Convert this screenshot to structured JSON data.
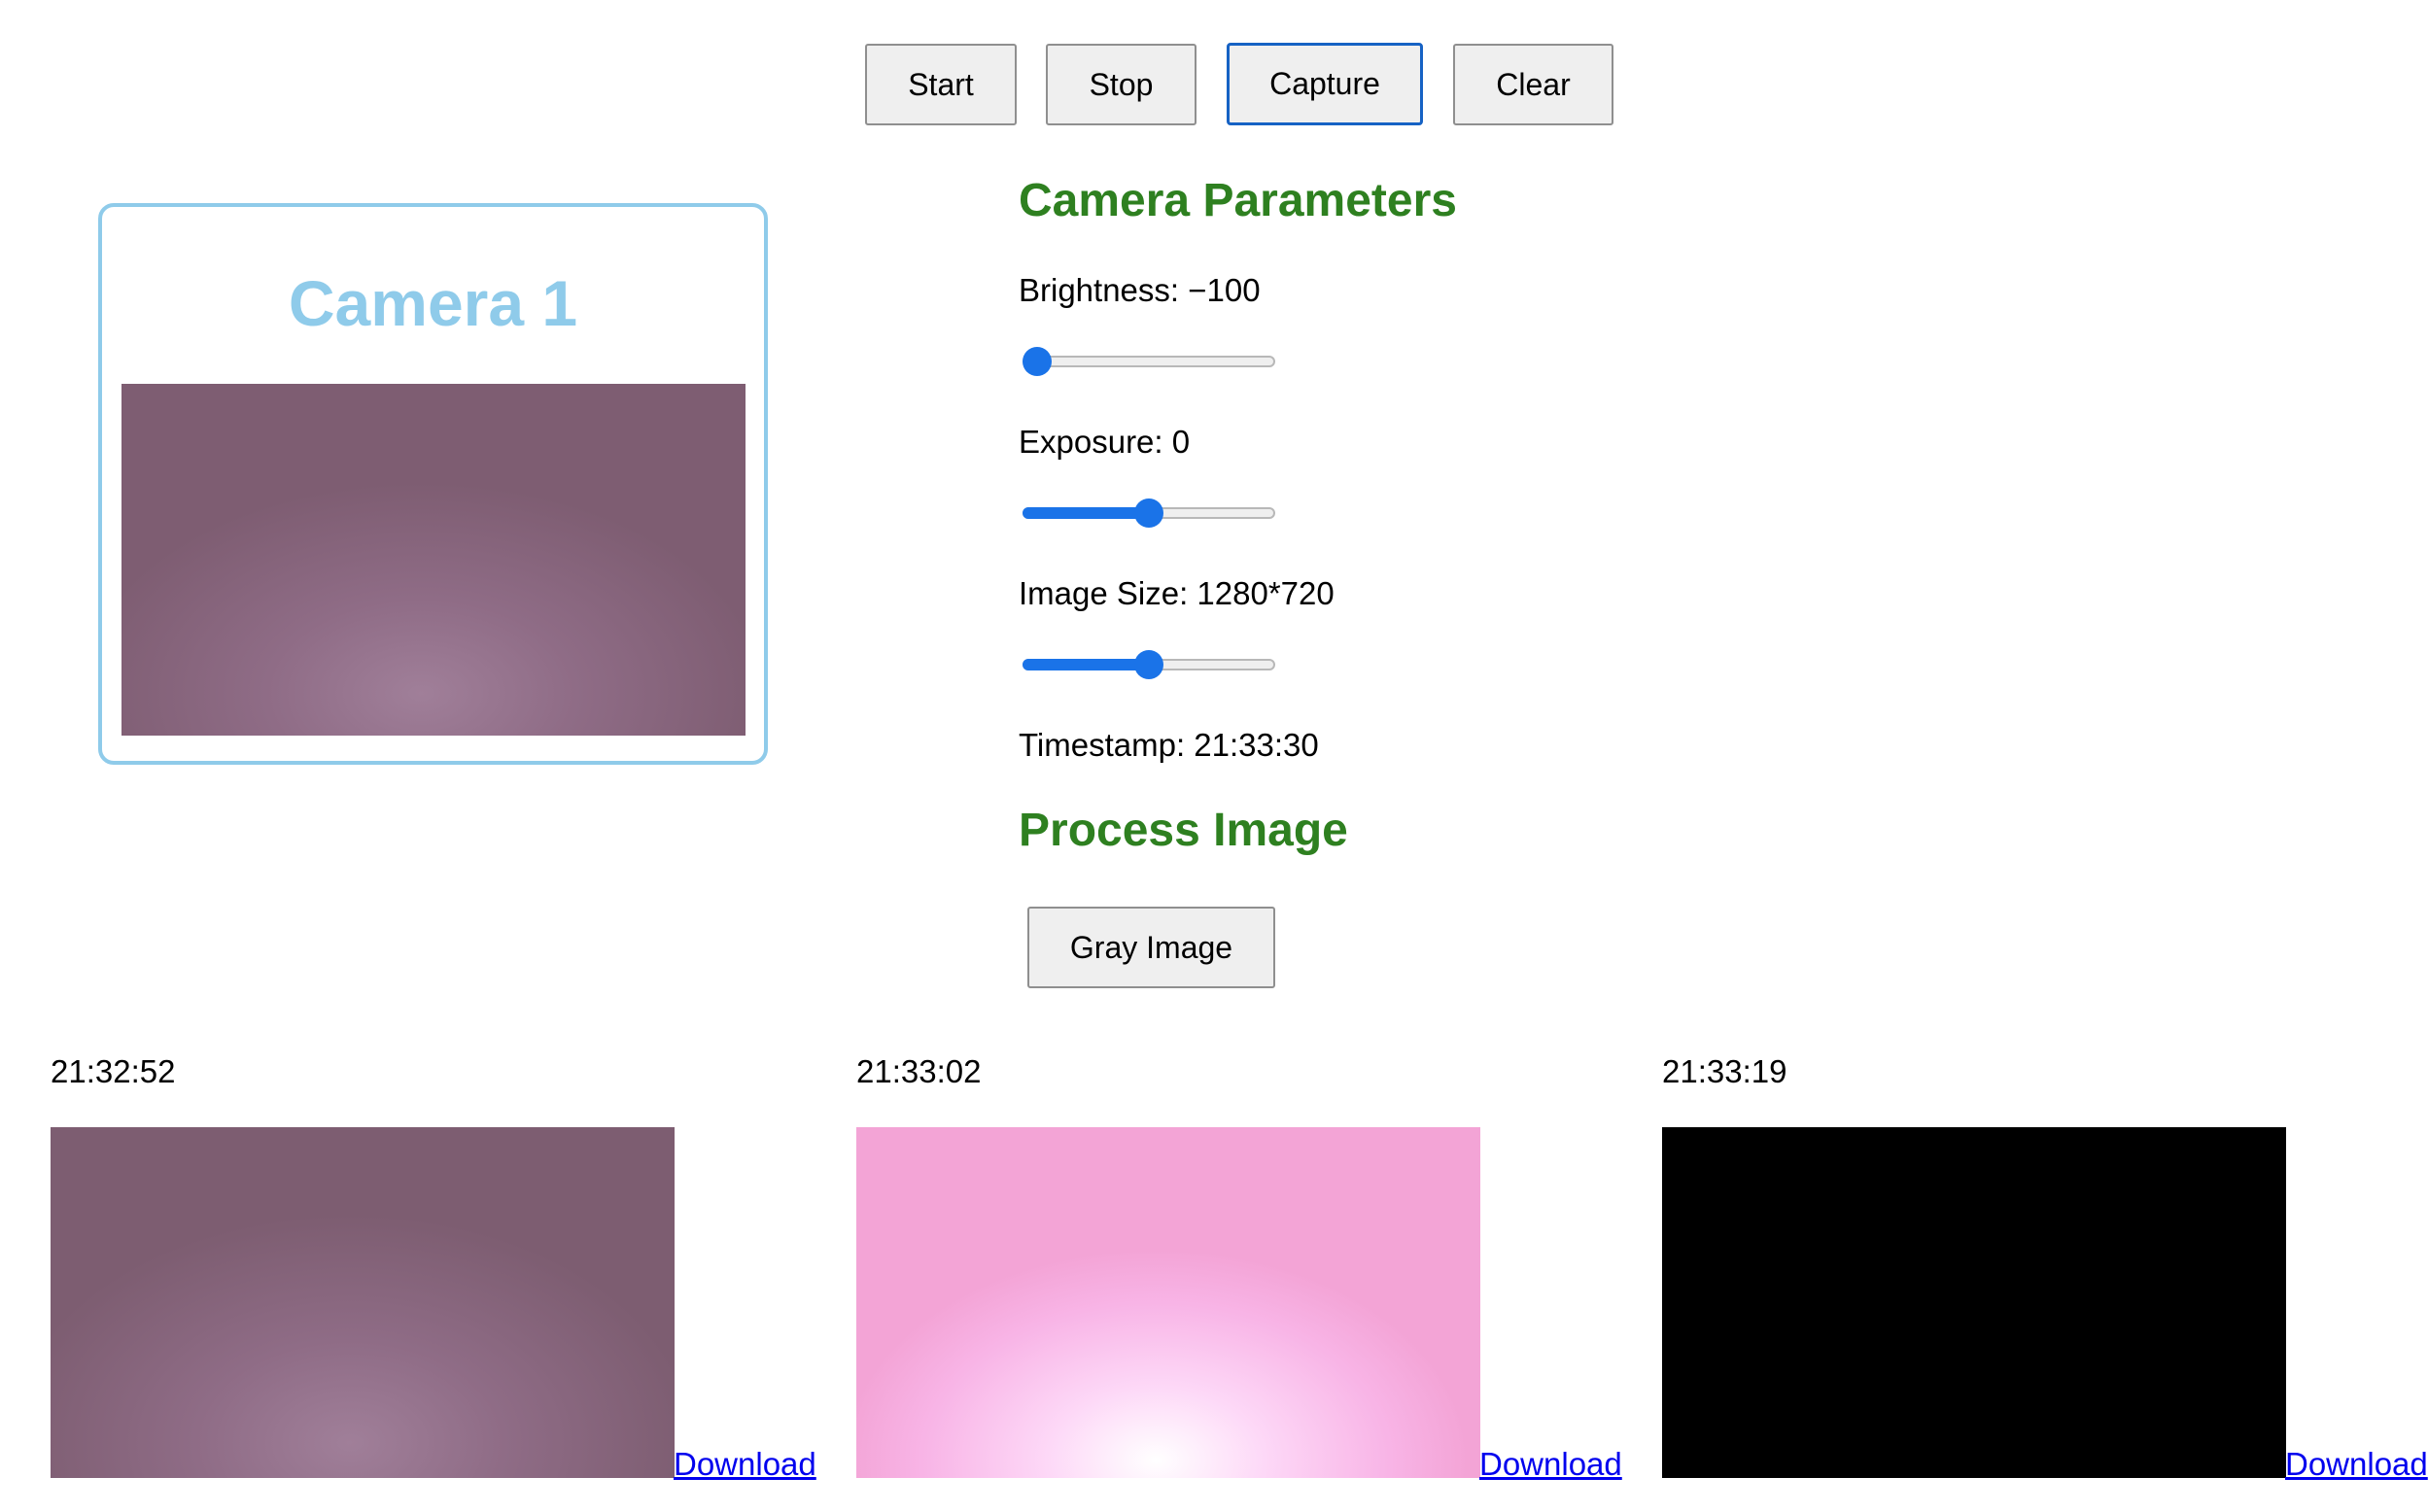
{
  "toolbar": {
    "start_label": "Start",
    "stop_label": "Stop",
    "capture_label": "Capture",
    "clear_label": "Clear"
  },
  "camera": {
    "title": "Camera 1"
  },
  "parameters": {
    "heading": "Camera Parameters",
    "brightness": {
      "label": "Brightness: −100",
      "value": -100,
      "fraction": 0.0
    },
    "exposure": {
      "label": "Exposure: 0",
      "value": 0,
      "fraction": 0.5
    },
    "image_size": {
      "label": "Image Size: 1280*720",
      "fraction": 0.5
    },
    "timestamp": "Timestamp: 21:33:30"
  },
  "process": {
    "heading": "Process Image",
    "gray_label": "Gray Image"
  },
  "captures": [
    {
      "time": "21:32:52",
      "download_label": "Download"
    },
    {
      "time": "21:33:02",
      "download_label": "Download"
    },
    {
      "time": "21:33:19",
      "download_label": "Download"
    }
  ],
  "colors": {
    "heading_green": "#2e8020",
    "camera_blue": "#8fcbea",
    "slider_blue": "#1a73e8",
    "link_blue": "#0000ee"
  }
}
